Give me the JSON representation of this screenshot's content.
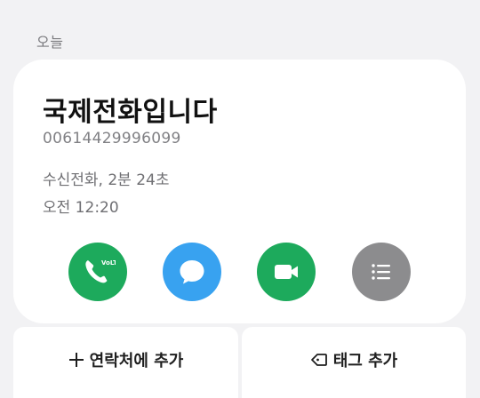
{
  "section": {
    "label": "오늘"
  },
  "call": {
    "name": "국제전화입니다",
    "number": "00614429996099",
    "info": "수신전화, 2분 24초",
    "time": "오전 12:20"
  },
  "actions": {
    "call_badge": "VoLTE",
    "call_icon": "phone-icon",
    "message_icon": "message-icon",
    "video_icon": "video-camera-icon",
    "more_icon": "list-icon"
  },
  "bottom": {
    "add_contact_label": "연락처에 추가",
    "add_tag_label": "태그 추가"
  },
  "colors": {
    "background": "#f2f2f4",
    "call_green": "#1daa5c",
    "message_blue": "#38a2f0",
    "more_gray": "#8c8c8e"
  }
}
